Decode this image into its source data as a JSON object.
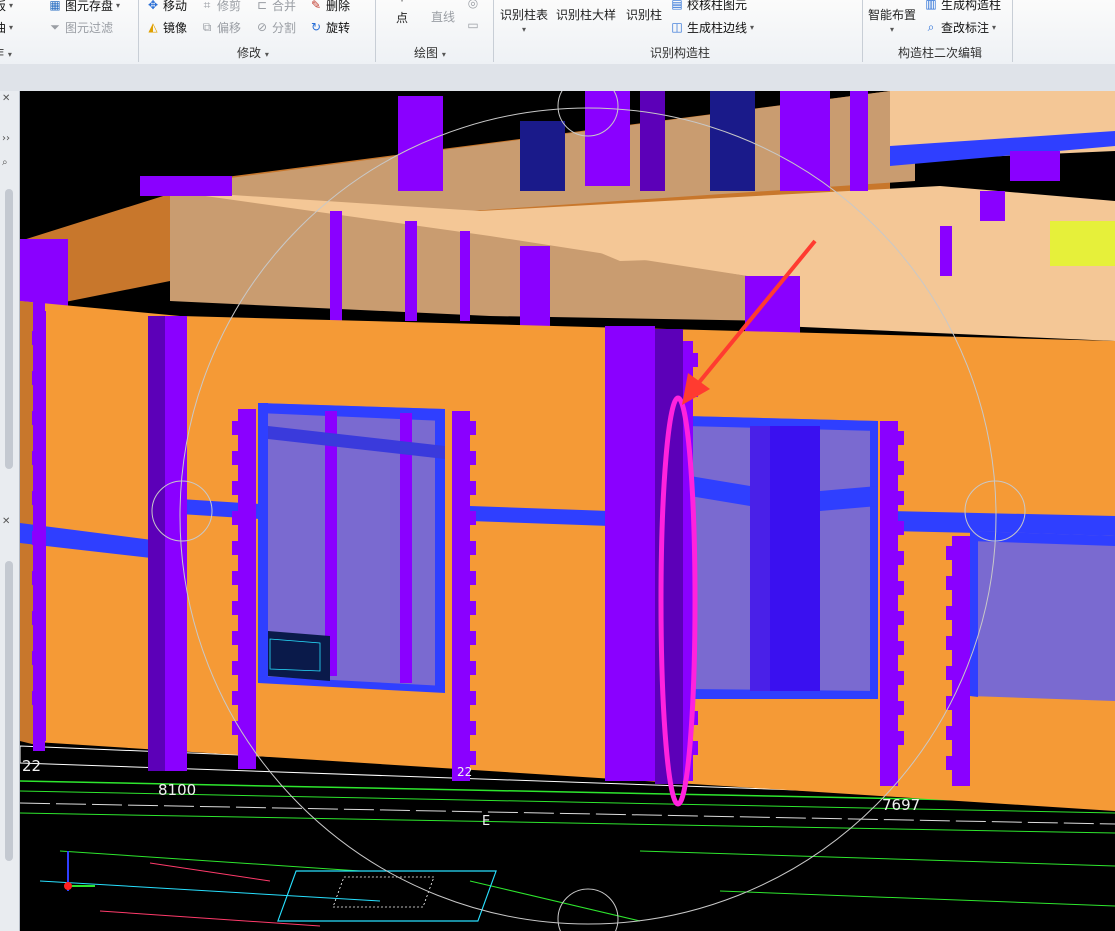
{
  "ribbon": {
    "groups": [
      {
        "title": "操作",
        "caret": "▾"
      },
      {
        "title": "修改",
        "caret": "▾"
      },
      {
        "title": "绘图",
        "caret": "▾"
      },
      {
        "title": "识别构造柱"
      },
      {
        "title": "构造柱二次编辑"
      }
    ],
    "col1": {
      "top_label": "板",
      "mid_label": "曲"
    },
    "col2": {
      "save": "图元存盘",
      "filter": "图元过滤"
    },
    "modify": {
      "move": "移动",
      "trim": "修剪",
      "merge": "合并",
      "delete": "删除",
      "mirror": "镜像",
      "offset": "偏移",
      "split": "分割",
      "rotate": "旋转"
    },
    "draw": {
      "point": "点",
      "line": "直线"
    },
    "recog": {
      "table": "识别柱表",
      "detail": "识别柱大样",
      "column": "识别柱",
      "check": "校核柱图元",
      "edges": "生成柱边线"
    },
    "edit2": {
      "smart": "智能布置",
      "generate": "生成构造柱",
      "check_mark": "查改标注"
    }
  },
  "viewport": {
    "dims": {
      "left_num": "22",
      "dim_a": "8100",
      "dim_b": "7697",
      "axis_e": "E",
      "axis_22": "22"
    },
    "colors": {
      "wall_orange": "#f59a36",
      "wall_dark": "#c8772c",
      "beam_tan": "#f4c796",
      "beam_shadow": "#c99c70",
      "column_purple": "#8a00ff",
      "column_dark": "#5c00b8",
      "window_glass": "#7a6ad0",
      "window_frame": "#2f3fff",
      "highlight": "#ff22dd",
      "arrow": "#ff3b30",
      "cad_green": "#2ee62e",
      "cad_cyan": "#28e0ff"
    },
    "annotation": {
      "shape": "ellipse",
      "pointer": "arrow"
    }
  }
}
